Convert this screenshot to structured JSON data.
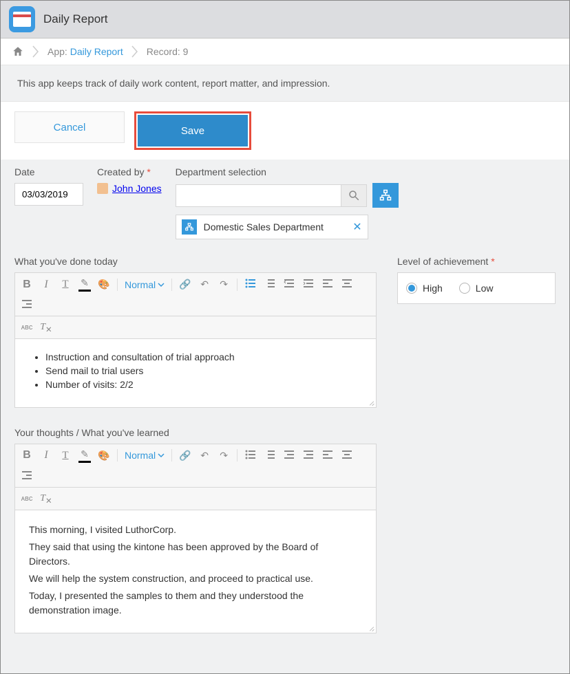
{
  "header": {
    "app_title": "Daily Report"
  },
  "breadcrumb": {
    "app_prefix": "App:",
    "app_link": "Daily Report",
    "record": "Record: 9"
  },
  "description": "This app keeps track of daily work content, report matter, and impression.",
  "actions": {
    "cancel": "Cancel",
    "save": "Save"
  },
  "fields": {
    "date": {
      "label": "Date",
      "value": "03/03/2019"
    },
    "creator": {
      "label": "Created by",
      "name": "John Jones"
    },
    "department": {
      "label": "Department selection",
      "selected": "Domestic Sales Department"
    },
    "done_today": {
      "label": "What you've done today",
      "items": [
        "Instruction and consultation of trial approach",
        "Send mail to trial users",
        "Number of visits: 2/2"
      ]
    },
    "thoughts": {
      "label": "Your thoughts / What you've learned",
      "lines": [
        "This morning, I visited LuthorCorp.",
        "They said that using the kintone has been approved by the Board of Directors.",
        "We will help the system construction, and proceed to practical use.",
        "Today, I presented the samples to them and they understood the demonstration image."
      ]
    },
    "achievement": {
      "label": "Level of achievement",
      "options": [
        "High",
        "Low"
      ],
      "selected": "High"
    }
  },
  "editor_toolbar": {
    "style_dropdown": "Normal"
  }
}
